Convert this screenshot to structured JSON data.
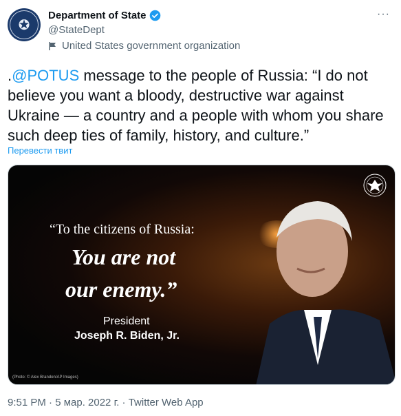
{
  "account": {
    "name": "Department of State",
    "handle": "@StateDept",
    "org_label": "United States government organization"
  },
  "tweet": {
    "prefix": ".",
    "mention": "@POTUS",
    "text": " message to the people of Russia: “I do not believe you want a bloody, destructive war against Ukraine — a country and a people with whom you share such deep ties of family, history, and culture.”",
    "translate_label": "Перевести твит"
  },
  "media": {
    "quote_line1": "“To the citizens of Russia:",
    "quote_line2": "You are not",
    "quote_line3": "our enemy.”",
    "attribution_title": "President",
    "attribution_name": "Joseph R. Biden, Jr.",
    "photo_credit": "(Photo: © Alex Brandon/AP Images)"
  },
  "meta": {
    "text": "9:51 PM · 5 мар. 2022 г. · Twitter Web App"
  },
  "colors": {
    "accent": "#1d9bf0",
    "text": "#0f1419",
    "secondary": "#536471"
  }
}
